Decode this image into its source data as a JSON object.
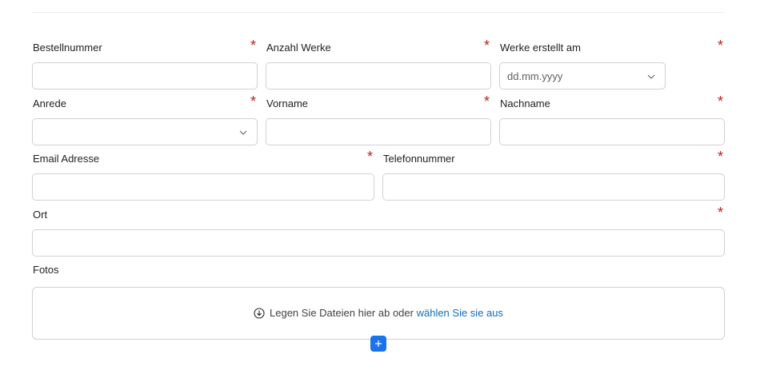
{
  "form": {
    "fields": {
      "order_number": {
        "label": "Bestellnummer",
        "required": "*",
        "value": ""
      },
      "works_count": {
        "label": "Anzahl Werke",
        "required": "*",
        "value": ""
      },
      "works_created": {
        "label": "Werke erstellt am",
        "required": "*",
        "placeholder": "dd.mm.yyyy",
        "icon": "chevron-down-icon"
      },
      "salutation": {
        "label": "Anrede",
        "required": "*",
        "value": "",
        "icon": "chevron-down-icon"
      },
      "first_name": {
        "label": "Vorname",
        "required": "*",
        "value": ""
      },
      "last_name": {
        "label": "Nachname",
        "required": "*",
        "value": ""
      },
      "email": {
        "label": "Email Adresse",
        "required": "*",
        "value": ""
      },
      "phone": {
        "label": "Telefonnummer",
        "required": "*",
        "value": ""
      },
      "city": {
        "label": "Ort",
        "required": "*",
        "value": ""
      }
    },
    "photos": {
      "label": "Fotos",
      "drop_text": "Legen Sie Dateien hier ab oder",
      "select_link": "wählen Sie sie aus",
      "icon": "download-circle-icon",
      "add_icon": "plus-icon"
    }
  },
  "colors": {
    "required": "#b3261e",
    "link": "#0f6cbd",
    "add_button": "#1a73e8",
    "border": "#d1d1d1"
  }
}
